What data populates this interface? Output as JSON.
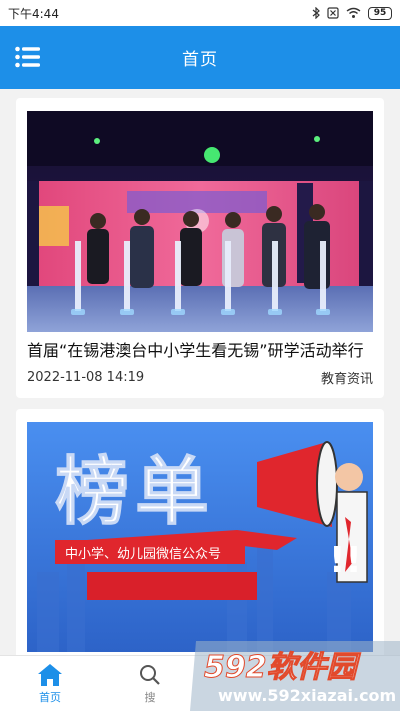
{
  "status_bar": {
    "time": "下午4:44",
    "battery": "95",
    "icons": [
      "bluetooth-icon",
      "sim-icon",
      "wifi-icon",
      "battery-icon"
    ]
  },
  "header": {
    "title": "首页",
    "menu_icon": "menu-icon"
  },
  "articles": [
    {
      "title": "首届“在锡港澳台中小学生看无锡”研学活动举行",
      "date": "2022-11-08 14:19",
      "category": "教育资讯"
    },
    {
      "title": "",
      "banner_main": "榜单",
      "banner_sub": "中小学、幼儿园微信公众号"
    }
  ],
  "tabs": [
    {
      "label": "首页",
      "icon": "home-icon",
      "active": true
    },
    {
      "label": "搜",
      "icon": "search-icon",
      "active": false
    }
  ],
  "watermark": {
    "brand": "592软件园",
    "url": "www.592xiazai.com"
  },
  "colors": {
    "primary": "#1d8fe8",
    "background": "#f2f2f2"
  }
}
